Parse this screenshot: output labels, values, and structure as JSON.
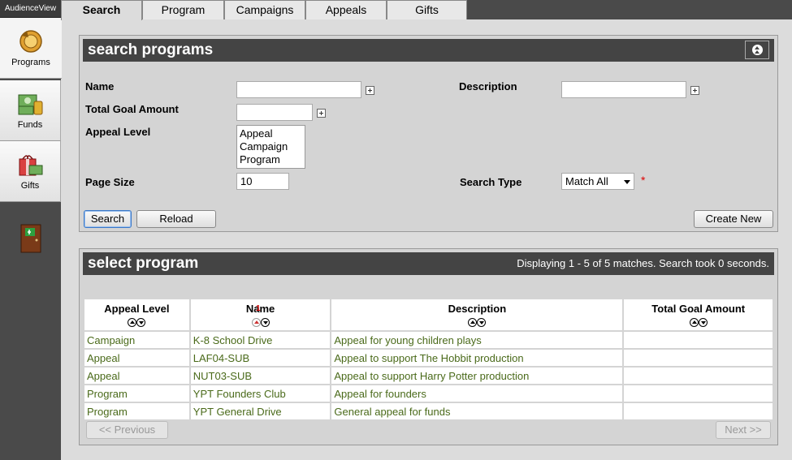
{
  "app": {
    "brand": "AudienceView"
  },
  "sidebar": {
    "items": [
      {
        "label": "Programs"
      },
      {
        "label": "Funds"
      },
      {
        "label": "Gifts"
      }
    ]
  },
  "tabs": [
    {
      "label": "Search"
    },
    {
      "label": "Program"
    },
    {
      "label": "Campaigns"
    },
    {
      "label": "Appeals"
    },
    {
      "label": "Gifts"
    }
  ],
  "search_panel": {
    "title": "search programs",
    "name_label": "Name",
    "name_value": "",
    "description_label": "Description",
    "description_value": "",
    "total_goal_label": "Total Goal Amount",
    "total_goal_value": "",
    "appeal_level_label": "Appeal Level",
    "appeal_level_options": [
      "Appeal",
      "Campaign",
      "Program"
    ],
    "page_size_label": "Page Size",
    "page_size_value": "10",
    "search_type_label": "Search Type",
    "search_type_value": "Match All",
    "required_mark": "*",
    "search_button": "Search",
    "reload_button": "Reload",
    "create_button": "Create New"
  },
  "results_panel": {
    "title": "select program",
    "status": "Displaying 1 - 5 of 5 matches. Search took 0 seconds.",
    "columns": [
      "Appeal Level",
      "Name",
      "Description",
      "Total Goal Amount"
    ],
    "sort_badge": "1",
    "rows": [
      {
        "level": "Campaign",
        "name": "K-8 School Drive",
        "description": "Appeal for young children plays",
        "goal": ""
      },
      {
        "level": "Appeal",
        "name": "LAF04-SUB",
        "description": "Appeal to support The Hobbit production",
        "goal": ""
      },
      {
        "level": "Appeal",
        "name": "NUT03-SUB",
        "description": "Appeal to support Harry Potter production",
        "goal": ""
      },
      {
        "level": "Program",
        "name": "YPT Founders Club",
        "description": "Appeal for founders",
        "goal": ""
      },
      {
        "level": "Program",
        "name": "YPT General Drive",
        "description": "General appeal for funds",
        "goal": ""
      }
    ],
    "prev_button": "<< Previous",
    "next_button": "Next >>"
  },
  "colors": {
    "header": "#444444",
    "link_text": "#4a6a1a",
    "sidebar": "#4a4a4a"
  },
  "icons": [
    "programs-icon",
    "funds-icon",
    "gifts-icon",
    "exit-door-icon",
    "collapse-icon",
    "plus-icon",
    "sort-ascending-icon",
    "sort-descending-icon",
    "dropdown-arrow-icon"
  ]
}
